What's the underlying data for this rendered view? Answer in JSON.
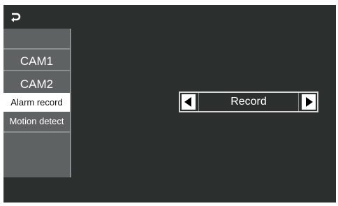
{
  "toolbar": {
    "back_icon": "return-arrow-icon"
  },
  "sidebar": {
    "items": [
      {
        "label": "CAM1",
        "selected": false
      },
      {
        "label": "CAM2",
        "selected": false
      },
      {
        "label": "Alarm record",
        "selected": true
      },
      {
        "label": "Motion detect",
        "selected": false
      }
    ]
  },
  "selector": {
    "value": "Record",
    "prev_icon": "triangle-left-icon",
    "next_icon": "triangle-right-icon"
  },
  "colors": {
    "background": "#2b2f2d",
    "sidebar": "#5f6263",
    "selected_item": "#ffffff",
    "text": "#ffffff"
  }
}
